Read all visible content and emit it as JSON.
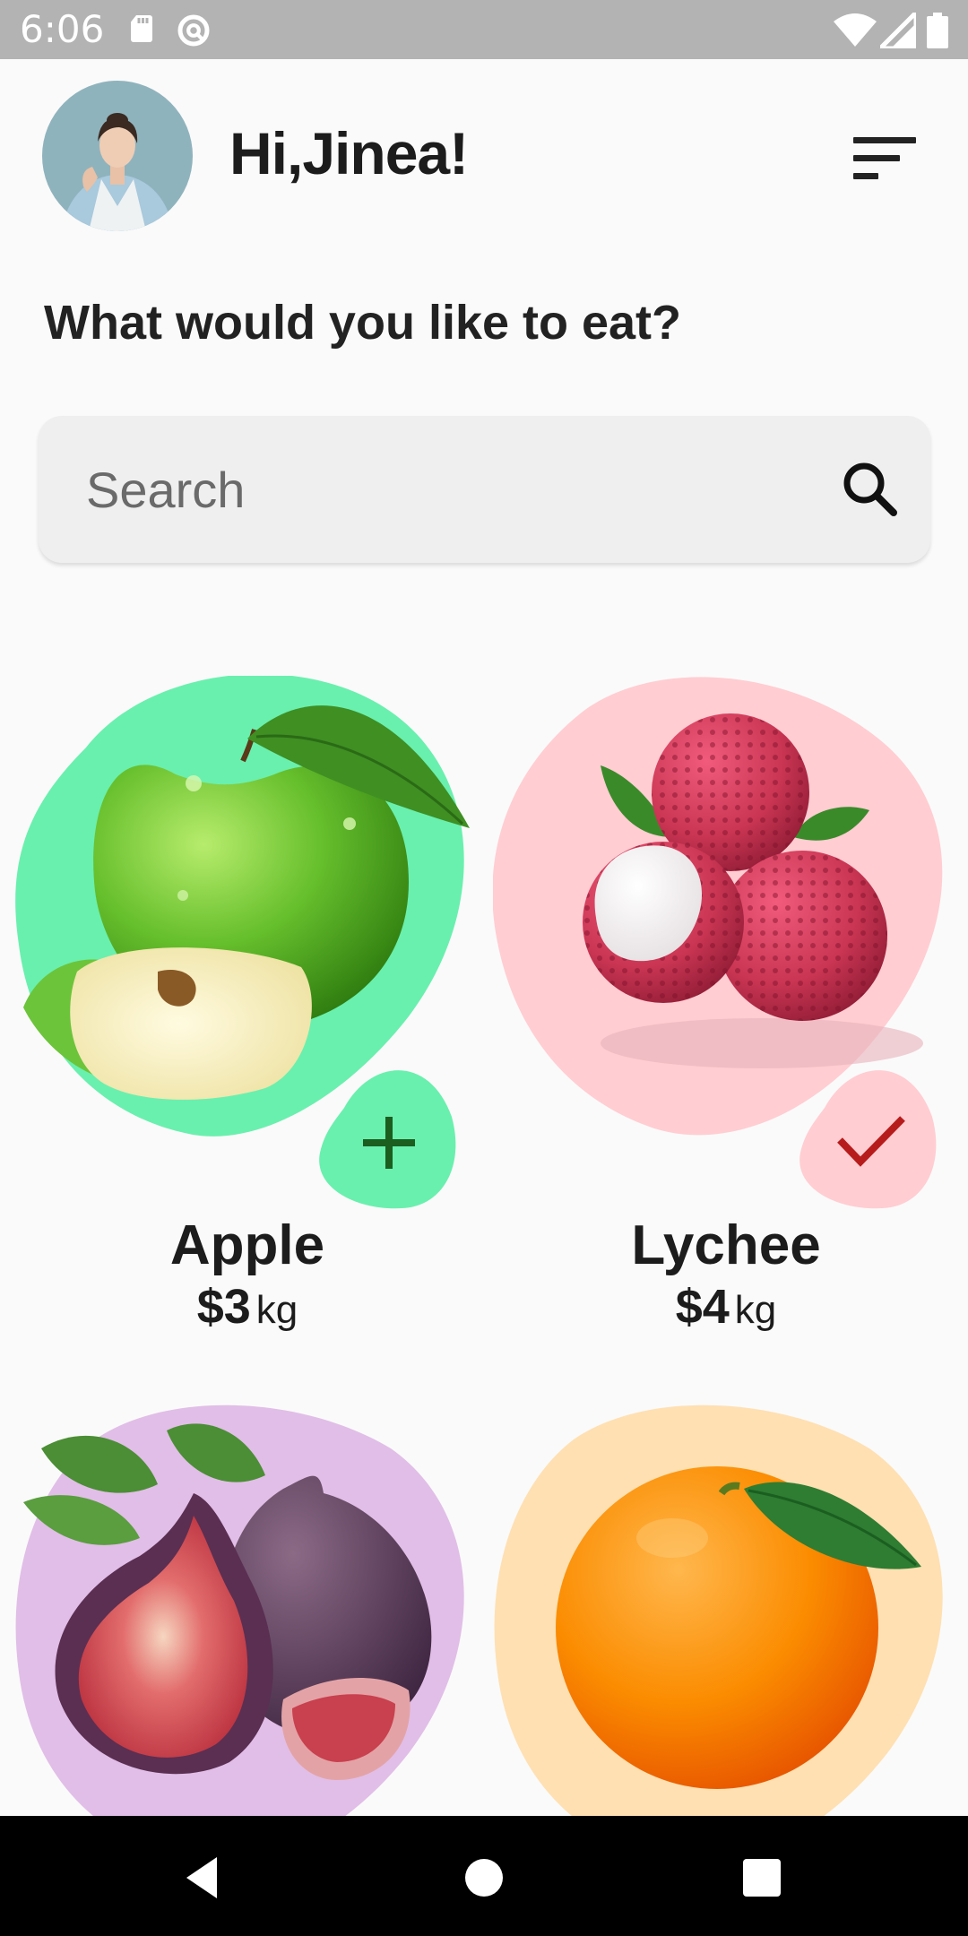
{
  "status_bar": {
    "time": "6:06",
    "left_icons": [
      "sd-card-icon",
      "at-sign-icon"
    ],
    "right_icons": [
      "wifi-icon",
      "signal-icon",
      "battery-icon"
    ]
  },
  "header": {
    "greeting": "Hi,Jinea!",
    "avatar": "avatar"
  },
  "prompt": "What would you like to eat?",
  "search": {
    "placeholder": "Search",
    "value": ""
  },
  "products": [
    {
      "name": "Apple",
      "price": "$3",
      "unit": "kg",
      "color": "#69f0ae",
      "action": "plus-icon",
      "action_color": "#1b5e20"
    },
    {
      "name": "Lychee",
      "price": "$4",
      "unit": "kg",
      "color": "#ffcdd2",
      "action": "checkmark-icon",
      "action_color": "#b71c1c"
    },
    {
      "name": "",
      "price": "",
      "unit": "",
      "color": "#e1bee7"
    },
    {
      "name": "",
      "price": "",
      "unit": "",
      "color": "#ffe0b2"
    }
  ],
  "nav_bar": {
    "icons": [
      "back-icon",
      "home-icon",
      "recents-icon"
    ]
  }
}
